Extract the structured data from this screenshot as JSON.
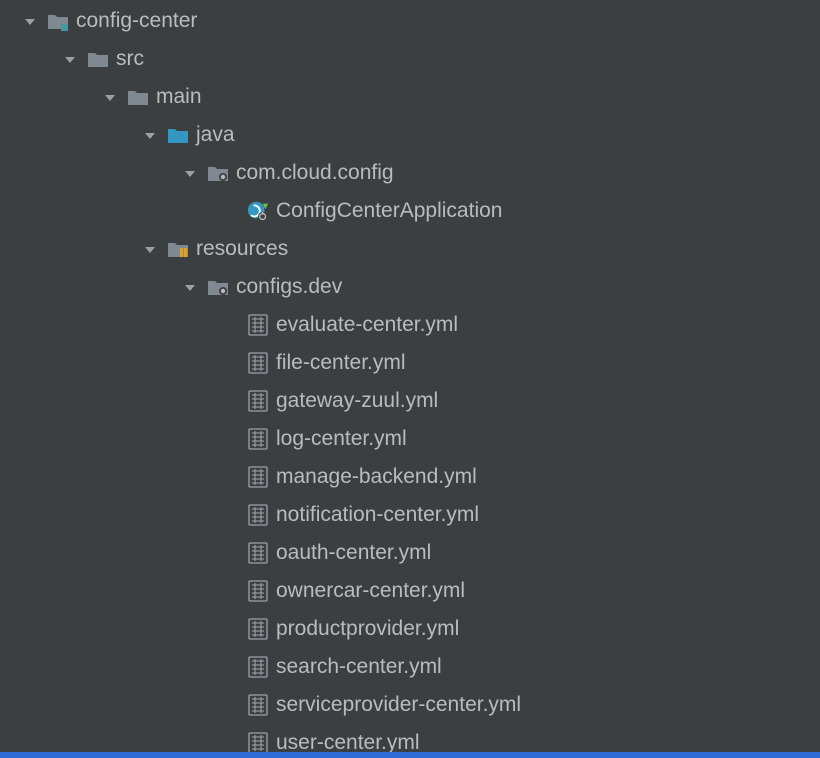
{
  "tree": {
    "name": "config-center",
    "icon": "module",
    "expanded": true,
    "children": [
      {
        "name": "src",
        "icon": "folder",
        "expanded": true,
        "children": [
          {
            "name": "main",
            "icon": "folder",
            "expanded": true,
            "children": [
              {
                "name": "java",
                "icon": "source-folder",
                "expanded": true,
                "children": [
                  {
                    "name": "com.cloud.config",
                    "icon": "package",
                    "expanded": true,
                    "children": [
                      {
                        "name": "ConfigCenterApplication",
                        "icon": "spring-app",
                        "expanded": false,
                        "children": []
                      }
                    ]
                  }
                ]
              },
              {
                "name": "resources",
                "icon": "resources-folder",
                "expanded": true,
                "children": [
                  {
                    "name": "configs.dev",
                    "icon": "package",
                    "expanded": true,
                    "children": [
                      {
                        "name": "evaluate-center.yml",
                        "icon": "yml",
                        "children": []
                      },
                      {
                        "name": "file-center.yml",
                        "icon": "yml",
                        "children": []
                      },
                      {
                        "name": "gateway-zuul.yml",
                        "icon": "yml",
                        "children": []
                      },
                      {
                        "name": "log-center.yml",
                        "icon": "yml",
                        "children": []
                      },
                      {
                        "name": "manage-backend.yml",
                        "icon": "yml",
                        "children": []
                      },
                      {
                        "name": "notification-center.yml",
                        "icon": "yml",
                        "children": []
                      },
                      {
                        "name": "oauth-center.yml",
                        "icon": "yml",
                        "children": []
                      },
                      {
                        "name": "ownercar-center.yml",
                        "icon": "yml",
                        "children": []
                      },
                      {
                        "name": "productprovider.yml",
                        "icon": "yml",
                        "children": []
                      },
                      {
                        "name": "search-center.yml",
                        "icon": "yml",
                        "children": []
                      },
                      {
                        "name": "serviceprovider-center.yml",
                        "icon": "yml",
                        "children": []
                      },
                      {
                        "name": "user-center.yml",
                        "icon": "yml",
                        "children": []
                      }
                    ]
                  }
                ]
              }
            ]
          }
        ]
      }
    ]
  },
  "indentBase": 20,
  "indentStep": 40
}
